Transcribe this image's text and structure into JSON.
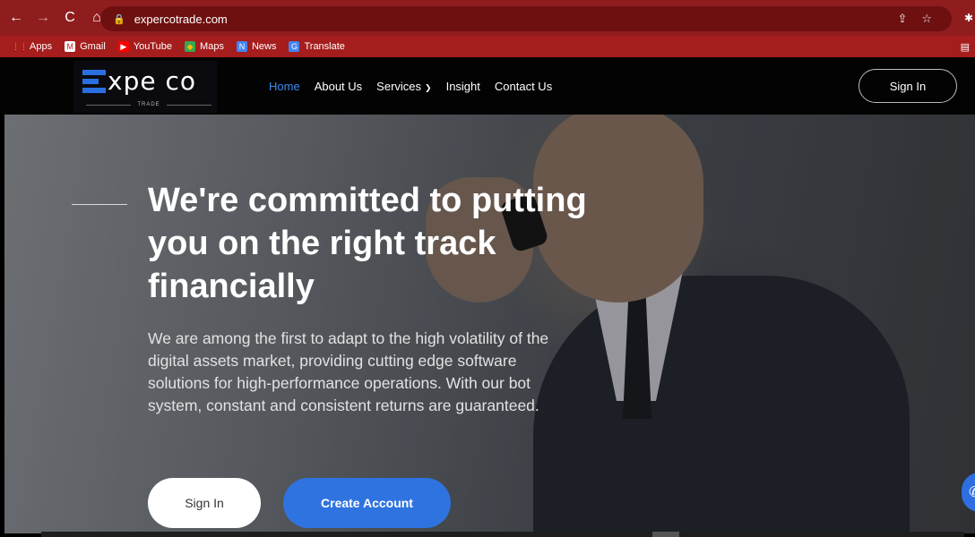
{
  "browser": {
    "url": "expercotrade.com",
    "bookmarks": [
      {
        "label": "Apps",
        "icon": "apps-grid-icon",
        "color": "#f4b400"
      },
      {
        "label": "Gmail",
        "icon": "gmail-icon",
        "color": "#ffffff"
      },
      {
        "label": "YouTube",
        "icon": "youtube-icon",
        "color": "#ff0000"
      },
      {
        "label": "Maps",
        "icon": "maps-icon",
        "color": "#34a853"
      },
      {
        "label": "News",
        "icon": "news-icon",
        "color": "#4285f4"
      },
      {
        "label": "Translate",
        "icon": "translate-icon",
        "color": "#4285f4"
      }
    ]
  },
  "site": {
    "logo_text": "xpe co",
    "logo_sub": "TRADE",
    "menu": [
      {
        "label": "Home",
        "active": true
      },
      {
        "label": "About Us",
        "active": false
      },
      {
        "label": "Services",
        "active": false,
        "dropdown": true
      },
      {
        "label": "Insight",
        "active": false
      },
      {
        "label": "Contact Us",
        "active": false
      }
    ],
    "sign_in_label": "Sign In"
  },
  "hero": {
    "title": "We're committed to putting you on the right track financially",
    "description": "We are among the first to adapt to the high volatility of the digital assets market, providing cutting edge software solutions for high-performance operations. With our bot system, constant and consistent returns are guaranteed.",
    "sign_in_label": "Sign In",
    "create_account_label": "Create Account"
  },
  "colors": {
    "accent": "#2f73e0",
    "active_link": "#3b8cf0",
    "browser_frame": "#8f1d1d"
  }
}
